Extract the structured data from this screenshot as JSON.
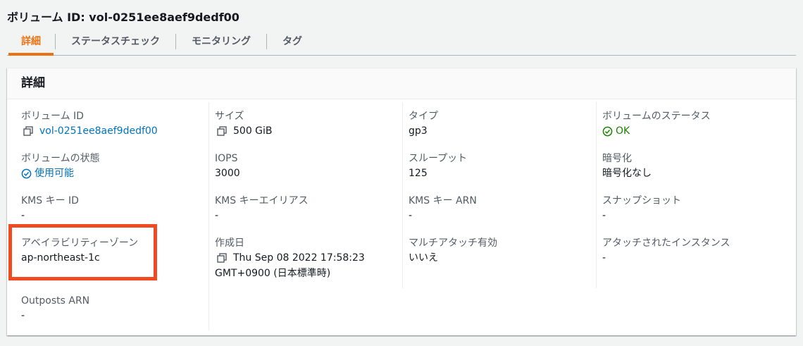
{
  "header": {
    "volume_title": "ボリューム ID: vol-0251ee8aef9dedf00"
  },
  "tabs": [
    {
      "label": "詳細",
      "active": true
    },
    {
      "label": "ステータスチェック",
      "active": false
    },
    {
      "label": "モニタリング",
      "active": false
    },
    {
      "label": "タグ",
      "active": false
    }
  ],
  "panel": {
    "title": "詳細"
  },
  "columns": {
    "col1": [
      {
        "label": "ボリューム ID",
        "value": "vol-0251ee8aef9dedf00"
      },
      {
        "label": "ボリュームの状態",
        "value": "使用可能"
      },
      {
        "label": "KMS キー ID",
        "value": "-"
      },
      {
        "label": "アベイラビリティーゾーン",
        "value": "ap-northeast-1c"
      },
      {
        "label": "Outposts ARN",
        "value": "-"
      }
    ],
    "col2": [
      {
        "label": "サイズ",
        "value": "500 GiB"
      },
      {
        "label": "IOPS",
        "value": "3000"
      },
      {
        "label": "KMS キーエイリアス",
        "value": "-"
      },
      {
        "label": "作成日",
        "value_line1": "Thu Sep 08 2022 17:58:23",
        "value_line2": "GMT+0900 (日本標準時)"
      }
    ],
    "col3": [
      {
        "label": "タイプ",
        "value": "gp3"
      },
      {
        "label": "スループット",
        "value": "125"
      },
      {
        "label": "KMS キー ARN",
        "value": "-"
      },
      {
        "label": "マルチアタッチ有効",
        "value": "いいえ"
      }
    ],
    "col4": [
      {
        "label": "ボリュームのステータス",
        "value": "OK"
      },
      {
        "label": "暗号化",
        "value": "暗号化なし"
      },
      {
        "label": "スナップショット",
        "value": "-"
      },
      {
        "label": "アタッチされたインスタンス",
        "value": "-"
      }
    ]
  },
  "colors": {
    "accent": "#ec7211",
    "link": "#0073bb",
    "ok": "#1d8102",
    "highlight": "#f04a23"
  },
  "icons": {
    "copy": "copy-icon",
    "status_ok": "check-circle-icon",
    "status_info": "check-circle-icon"
  }
}
